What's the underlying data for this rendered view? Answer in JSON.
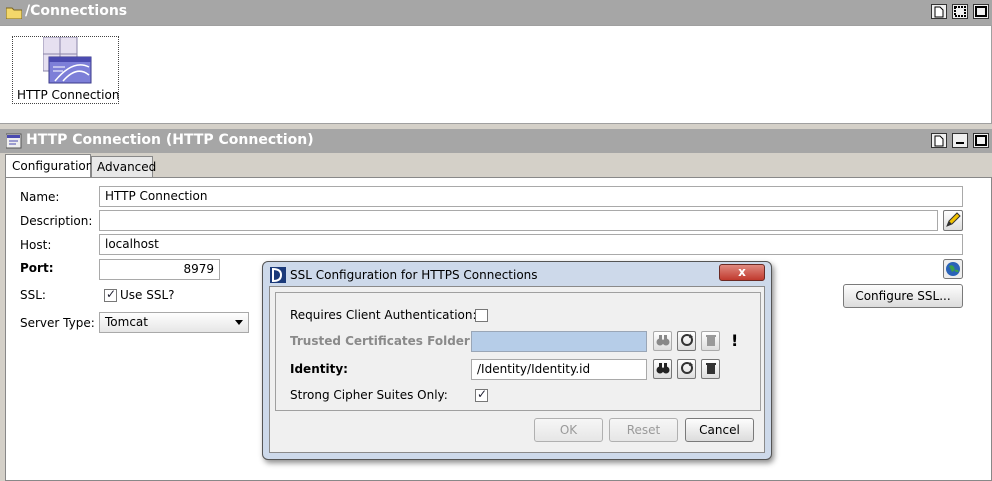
{
  "top_panel": {
    "title": "/Connections",
    "item_label": "HTTP Connection"
  },
  "editor": {
    "title": "HTTP Connection (HTTP Connection)",
    "tabs": [
      "Configuration",
      "Advanced"
    ],
    "name_label": "Name:",
    "name_value": "HTTP Connection",
    "description_label": "Description:",
    "description_value": "",
    "host_label": "Host:",
    "host_value": "localhost",
    "port_label": "Port:",
    "port_value": "8979",
    "ssl_label": "SSL:",
    "use_ssl_label": "Use SSL?",
    "server_type_label": "Server Type:",
    "server_type_value": "Tomcat",
    "configure_ssl_label": "Configure SSL..."
  },
  "dialog": {
    "title": "SSL Configuration for HTTPS Connections",
    "close_glyph": "x",
    "requires_client_auth_label": "Requires Client Authentication:",
    "trusted_certs_label": "Trusted Certificates Folder:",
    "trusted_certs_value": "",
    "warning_glyph": "!",
    "identity_label": "Identity:",
    "identity_value": "/Identity/Identity.id",
    "strong_cipher_label": "Strong Cipher Suites Only:",
    "ok_label": "OK",
    "reset_label": "Reset",
    "cancel_label": "Cancel"
  },
  "colors": {
    "titlebar": "#a6a6a6",
    "dialog_title_bg": "#c9d7ea",
    "close_button": "#c9473d",
    "trusted_field_bg": "#b6cde8"
  }
}
